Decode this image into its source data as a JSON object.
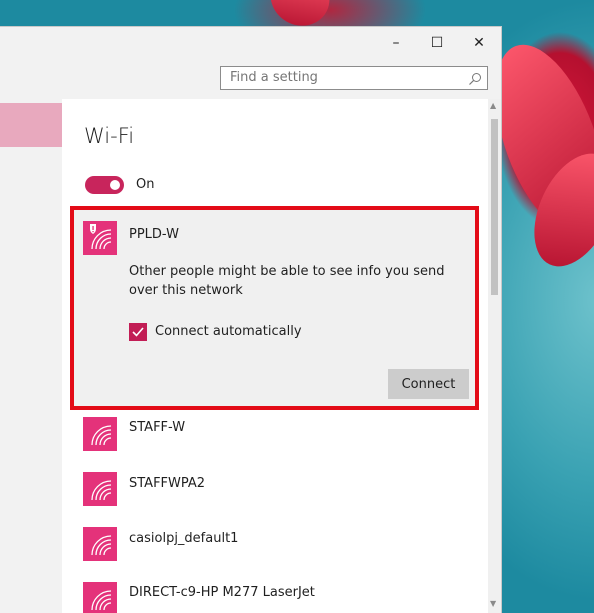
{
  "window": {
    "controls": {
      "minimize": "–",
      "maximize": "☐",
      "close": "✕"
    }
  },
  "search": {
    "placeholder": "Find a setting"
  },
  "page": {
    "title": "Wi-Fi",
    "wifi_toggle": {
      "state_label": "On",
      "on": true
    }
  },
  "selected_network": {
    "name": "PPLD-W",
    "warning": "Other people might be able to see info you send over this network",
    "connect_automatically": {
      "label": "Connect automatically",
      "checked": true
    },
    "connect_label": "Connect"
  },
  "networks": [
    {
      "name": "STAFF-W"
    },
    {
      "name": "STAFFWPA2"
    },
    {
      "name": "casiolpj_default1"
    },
    {
      "name": "DIRECT-c9-HP M277 LaserJet"
    }
  ],
  "colors": {
    "accent": "#c8255c",
    "tile": "#e4327a",
    "highlight_border": "#e30b17"
  }
}
